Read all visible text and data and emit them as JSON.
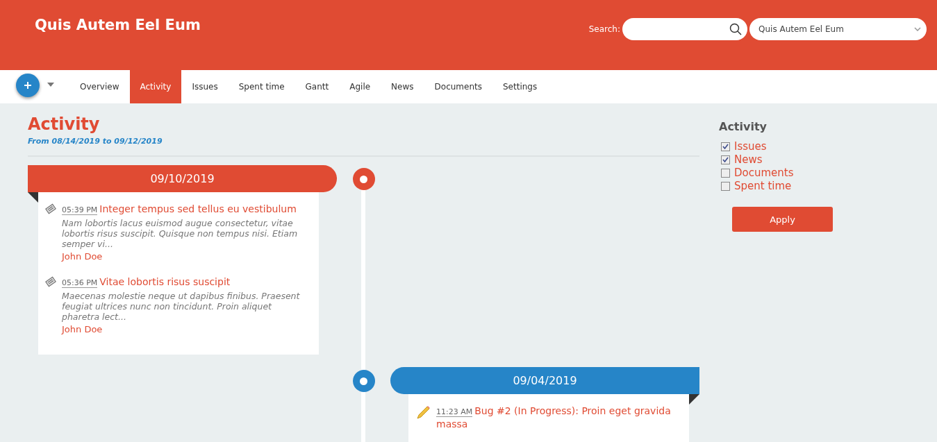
{
  "header": {
    "title": "Quis Autem Eel Eum",
    "search_label": "Search:",
    "project_select": "Quis Autem Eel Eum"
  },
  "tabs": [
    {
      "label": "Overview",
      "selected": false
    },
    {
      "label": "Activity",
      "selected": true
    },
    {
      "label": "Issues",
      "selected": false
    },
    {
      "label": "Spent time",
      "selected": false
    },
    {
      "label": "Gantt",
      "selected": false
    },
    {
      "label": "Agile",
      "selected": false
    },
    {
      "label": "News",
      "selected": false
    },
    {
      "label": "Documents",
      "selected": false
    },
    {
      "label": "Settings",
      "selected": false
    }
  ],
  "main": {
    "title": "Activity",
    "range": "From 08/14/2019 to 09/12/2019",
    "days": [
      {
        "date": "09/10/2019",
        "kind": "left",
        "color": "#e04b33",
        "entries": [
          {
            "kind": "news",
            "time": "05:39 PM",
            "title": "Integer tempus sed tellus eu vestibulum",
            "description": "Nam lobortis lacus euismod augue consectetur, vitae lobortis risus suscipit. Quisque non tempus nisi. Etiam semper vi...",
            "author": "John Doe"
          },
          {
            "kind": "news",
            "time": "05:36 PM",
            "title": "Vitae lobortis risus suscipit",
            "description": "Maecenas molestie neque ut dapibus finibus. Praesent feugiat ultrices nunc non tincidunt. Proin aliquet pharetra lect...",
            "author": "John Doe"
          }
        ]
      },
      {
        "date": "09/04/2019",
        "kind": "right",
        "color": "#2685c8",
        "entries": [
          {
            "kind": "edit",
            "time": "11:23 AM",
            "title": "Bug #2 (In Progress): Proin eget gravida massa"
          }
        ]
      }
    ]
  },
  "sidebar": {
    "title": "Activity",
    "filters": [
      {
        "label": "Issues",
        "checked": true
      },
      {
        "label": "News",
        "checked": true
      },
      {
        "label": "Documents",
        "checked": false
      },
      {
        "label": "Spent time",
        "checked": false
      }
    ],
    "button": "Apply"
  }
}
